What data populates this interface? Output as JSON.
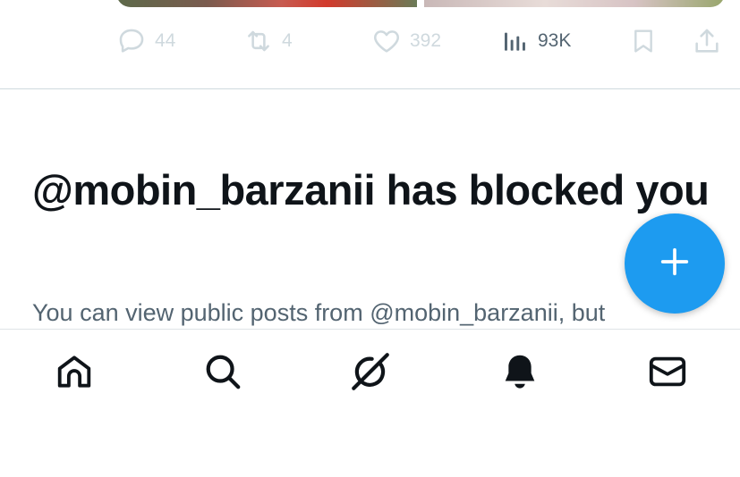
{
  "post_actions": {
    "replies": "44",
    "reposts": "4",
    "likes": "392",
    "views": "93K"
  },
  "blocked": {
    "headline": "@mobin_barzanii has blocked you",
    "message": "You can view public posts from @mobin_barzanii, but"
  },
  "icons": {
    "reply": "speech-bubble-icon",
    "repost": "repost-arrows-icon",
    "like": "heart-icon",
    "views": "bar-chart-icon",
    "bookmark": "bookmark-icon",
    "share": "share-upload-icon",
    "compose": "plus-icon",
    "nav": [
      "home-icon",
      "search-icon",
      "grok-icon",
      "bell-icon",
      "mail-icon"
    ]
  },
  "colors": {
    "accent": "#1d9bf0",
    "muted_text": "#536471",
    "faded_icon": "#cfd9de",
    "text": "#0f1419"
  }
}
